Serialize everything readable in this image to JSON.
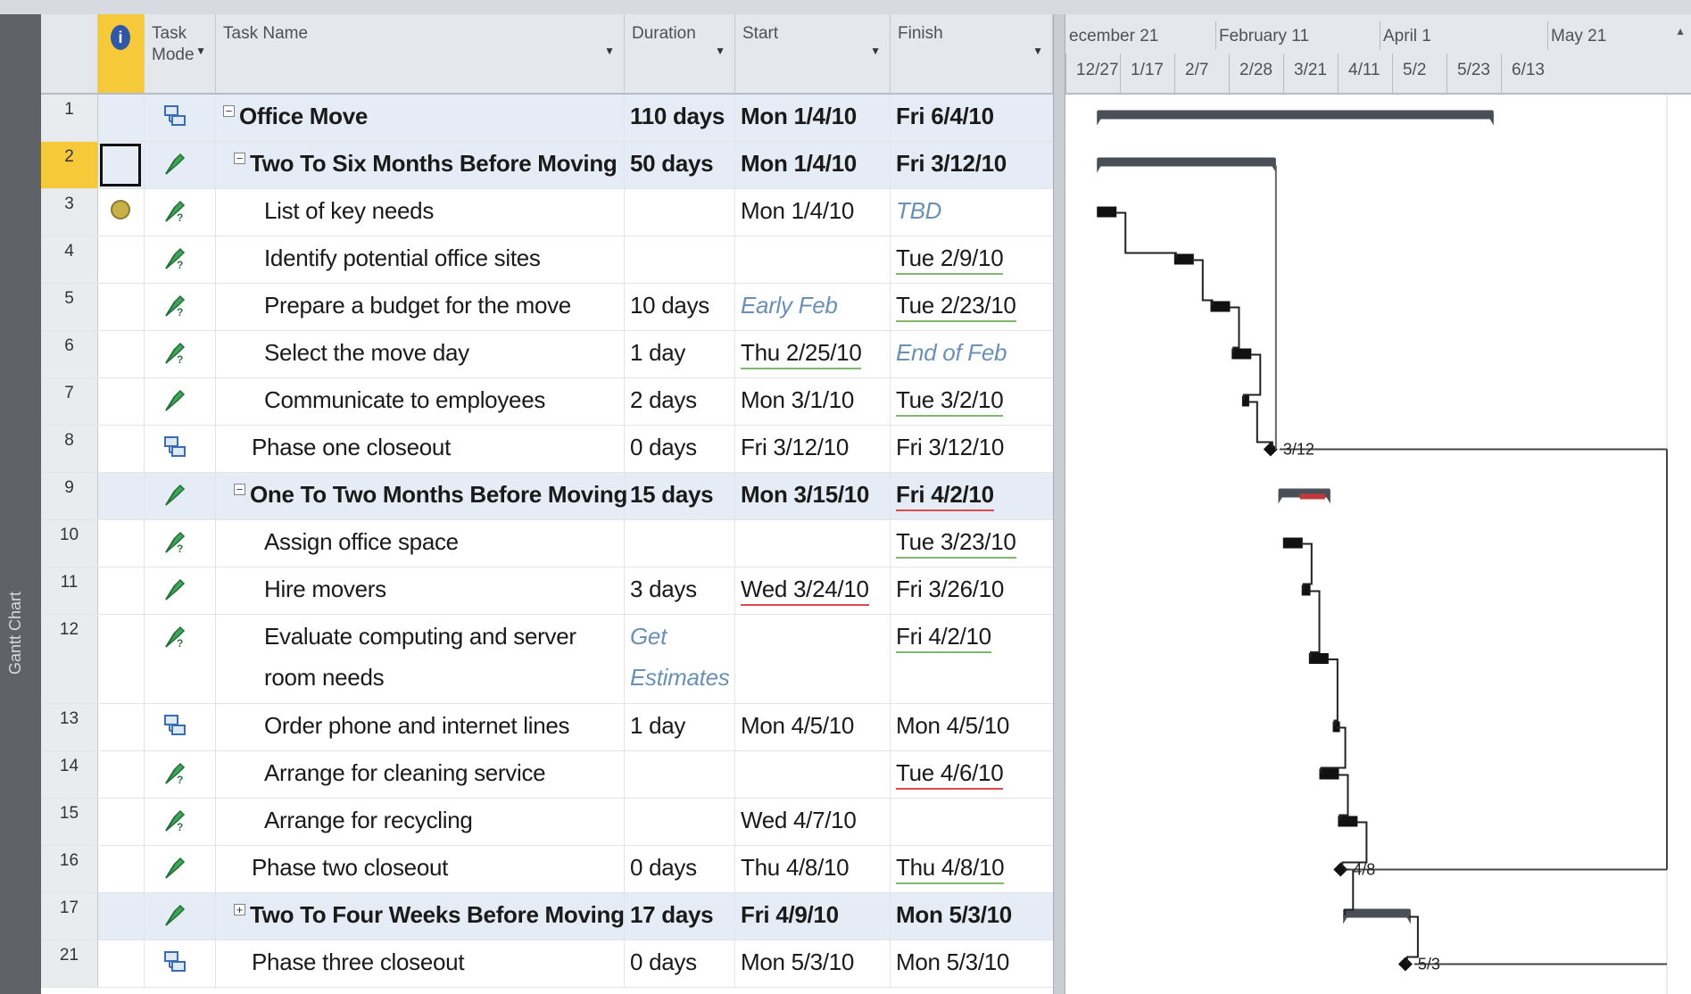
{
  "view_label": "Gantt Chart",
  "columns": {
    "indicators_symbol": "i",
    "task_mode": "Task\nMode",
    "task_name": "Task Name",
    "duration": "Duration",
    "start": "Start",
    "finish": "Finish"
  },
  "timescale": {
    "major": [
      "ecember 21",
      "February 11",
      "April 1",
      "May 21"
    ],
    "minor": [
      "12/27",
      "1/17",
      "2/7",
      "2/28",
      "3/21",
      "4/11",
      "5/2",
      "5/23",
      "6/13"
    ]
  },
  "rows": [
    {
      "id": "1",
      "mode": "auto",
      "level": 0,
      "summary": true,
      "name": "Office Move",
      "duration": "110 days",
      "start": "Mon 1/4/10",
      "finish": "Fri 6/4/10"
    },
    {
      "id": "2",
      "mode": "manual",
      "level": 1,
      "summary": true,
      "selected": true,
      "name": "Two To Six Months Before Moving",
      "duration": "50 days",
      "start": "Mon 1/4/10",
      "finish": "Fri 3/12/10"
    },
    {
      "id": "3",
      "mode": "manual-est",
      "level": 2,
      "note": true,
      "name": "List of key needs",
      "duration": "",
      "start": "Mon 1/4/10",
      "finish": "TBD",
      "finish_hint": true
    },
    {
      "id": "4",
      "mode": "manual-est",
      "level": 2,
      "name": "Identify potential office sites",
      "duration": "",
      "start": "",
      "finish": "Tue 2/9/10",
      "finish_ul": "green"
    },
    {
      "id": "5",
      "mode": "manual-est",
      "level": 2,
      "name": "Prepare a budget for the move",
      "duration": "10 days",
      "start": "Early Feb",
      "start_hint": true,
      "finish": "Tue 2/23/10",
      "finish_ul": "green"
    },
    {
      "id": "6",
      "mode": "manual-est",
      "level": 2,
      "name": "Select the move day",
      "duration": "1 day",
      "start": "Thu 2/25/10",
      "start_ul": "green",
      "finish": "End of Feb",
      "finish_hint": true
    },
    {
      "id": "7",
      "mode": "manual",
      "level": 2,
      "name": "Communicate to employees",
      "duration": "2 days",
      "start": "Mon 3/1/10",
      "finish": "Tue 3/2/10",
      "finish_ul": "green"
    },
    {
      "id": "8",
      "mode": "auto",
      "level": 1,
      "name": "Phase one closeout",
      "duration": "0 days",
      "start": "Fri 3/12/10",
      "finish": "Fri 3/12/10"
    },
    {
      "id": "9",
      "mode": "manual",
      "level": 1,
      "summary": true,
      "name": "One To Two Months Before Moving",
      "duration": "15 days",
      "start": "Mon 3/15/10",
      "finish": "Fri 4/2/10",
      "finish_ul": "red"
    },
    {
      "id": "10",
      "mode": "manual-est",
      "level": 2,
      "name": "Assign office space",
      "duration": "",
      "start": "",
      "finish": "Tue 3/23/10",
      "finish_ul": "green"
    },
    {
      "id": "11",
      "mode": "manual",
      "level": 2,
      "name": "Hire movers",
      "duration": "3 days",
      "start": "Wed 3/24/10",
      "start_ul": "red",
      "finish": "Fri 3/26/10"
    },
    {
      "id": "12",
      "mode": "manual-est",
      "level": 2,
      "tall": true,
      "name": "Evaluate computing and server",
      "name2": "room needs",
      "duration": "Get",
      "duration2": "Estimates",
      "duration_hint": true,
      "start": "",
      "finish": "Fri 4/2/10",
      "finish_ul": "green"
    },
    {
      "id": "13",
      "mode": "auto",
      "level": 2,
      "name": "Order phone and internet lines",
      "duration": "1 day",
      "start": "Mon 4/5/10",
      "finish": "Mon 4/5/10"
    },
    {
      "id": "14",
      "mode": "manual-est",
      "level": 2,
      "name": "Arrange for cleaning service",
      "duration": "",
      "start": "",
      "finish": "Tue 4/6/10",
      "finish_ul": "red"
    },
    {
      "id": "15",
      "mode": "manual-est",
      "level": 2,
      "name": "Arrange for recycling",
      "duration": "",
      "start": "Wed 4/7/10",
      "finish": ""
    },
    {
      "id": "16",
      "mode": "manual",
      "level": 1,
      "name": "Phase two closeout",
      "duration": "0 days",
      "start": "Thu 4/8/10",
      "finish": "Thu 4/8/10",
      "finish_ul": "green"
    },
    {
      "id": "17",
      "mode": "manual",
      "level": 1,
      "summary": true,
      "collapsed": true,
      "name": "Two To Four Weeks Before Moving",
      "duration": "17 days",
      "start": "Fri 4/9/10",
      "finish": "Mon 5/3/10"
    },
    {
      "id": "21",
      "mode": "auto",
      "level": 1,
      "name": "Phase three closeout",
      "duration": "0 days",
      "start": "Mon 5/3/10",
      "finish": "Mon 5/3/10"
    }
  ],
  "milestone_labels": [
    "3/12",
    "4/8",
    "5/3"
  ],
  "colors": {
    "header_bg": "#e4e7ec",
    "selected_header": "#f6c93b",
    "summary_row": "#e6ecf5",
    "summary_bar": "#4a4e55",
    "bar_black": "#111111",
    "late_bar": "#c43a3a",
    "hint_text": "#6a90b5"
  }
}
